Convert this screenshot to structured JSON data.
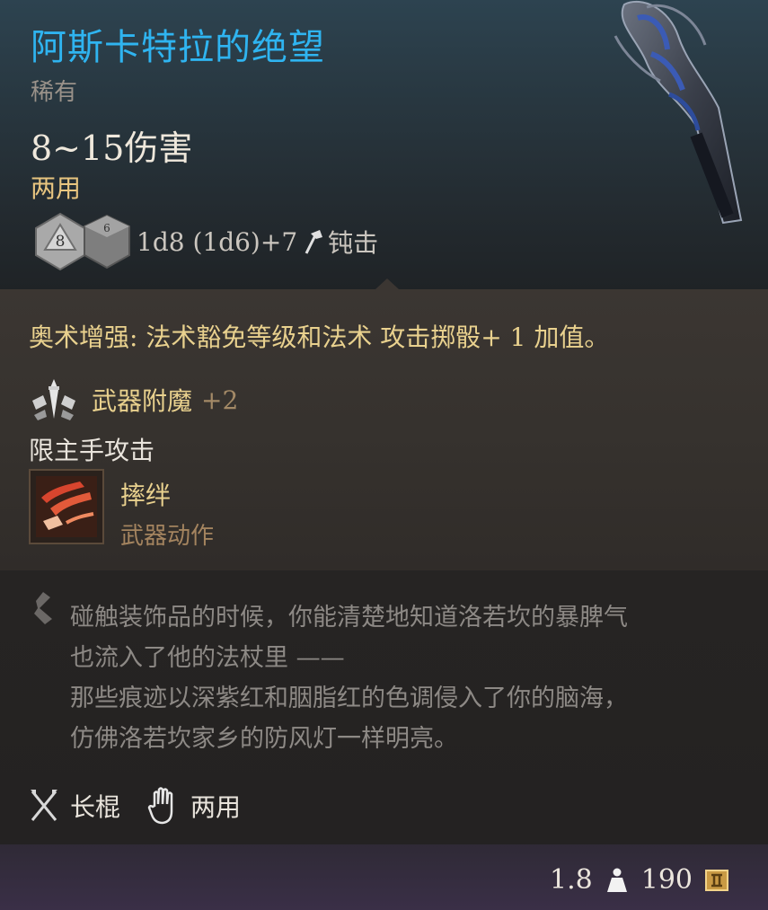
{
  "item": {
    "name": "阿斯卡特拉的绝望",
    "rarity": "稀有",
    "damage": "8~15伤害",
    "handedness": "两用",
    "dice": {
      "d8_label": "8",
      "d6_label": "6",
      "formula": "1d8 (1d6)+7",
      "damage_type": "钝击"
    },
    "passive": "奥术增强: 法术豁免等级和法术 攻击掷骰+ 1 加值。",
    "enchantment": {
      "label": "武器附魔",
      "bonus": "+2"
    },
    "restriction": "限主手攻击",
    "action": {
      "name": "摔绊",
      "type": "武器动作"
    },
    "lore_lines": [
      "碰触装饰品的时候，你能清楚地知道洛若坎的暴脾气",
      "也流入了他的法杖里 ——",
      "那些痕迹以深紫红和胭脂红的色调侵入了你的脑海，",
      "仿佛洛若坎家乡的防风灯一样明亮。"
    ],
    "properties": [
      {
        "label": "长棍",
        "icon": "crossed-staves-icon"
      },
      {
        "label": "两用",
        "icon": "hand-icon"
      }
    ],
    "weight": "1.8",
    "price": "190"
  },
  "colors": {
    "title": "#2fb4f0",
    "gold_text": "#e9d18e",
    "muted_text": "#8d8985"
  }
}
